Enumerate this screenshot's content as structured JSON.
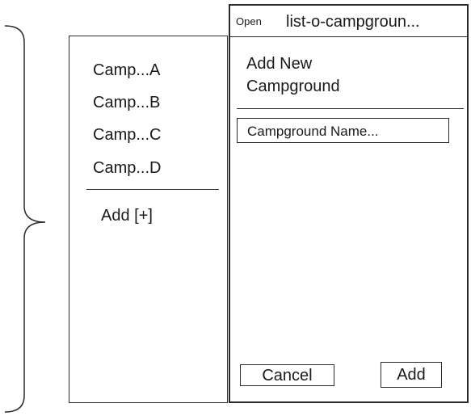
{
  "campground_list": {
    "items": [
      {
        "label": "Camp...A"
      },
      {
        "label": "Camp...B"
      },
      {
        "label": "Camp...C"
      },
      {
        "label": "Camp...D"
      }
    ],
    "add_label": "Add [+]"
  },
  "new_window": {
    "open_label": "Open",
    "title": "list-o-campgroun...",
    "heading": "Add New Campground",
    "name_input": {
      "value": "",
      "placeholder": "Campground Name..."
    },
    "cancel_label": "Cancel",
    "add_label": "Add"
  },
  "colors": {
    "stroke": "#2a2a2a",
    "background": "#ffffff",
    "text": "#1a1a1a"
  }
}
